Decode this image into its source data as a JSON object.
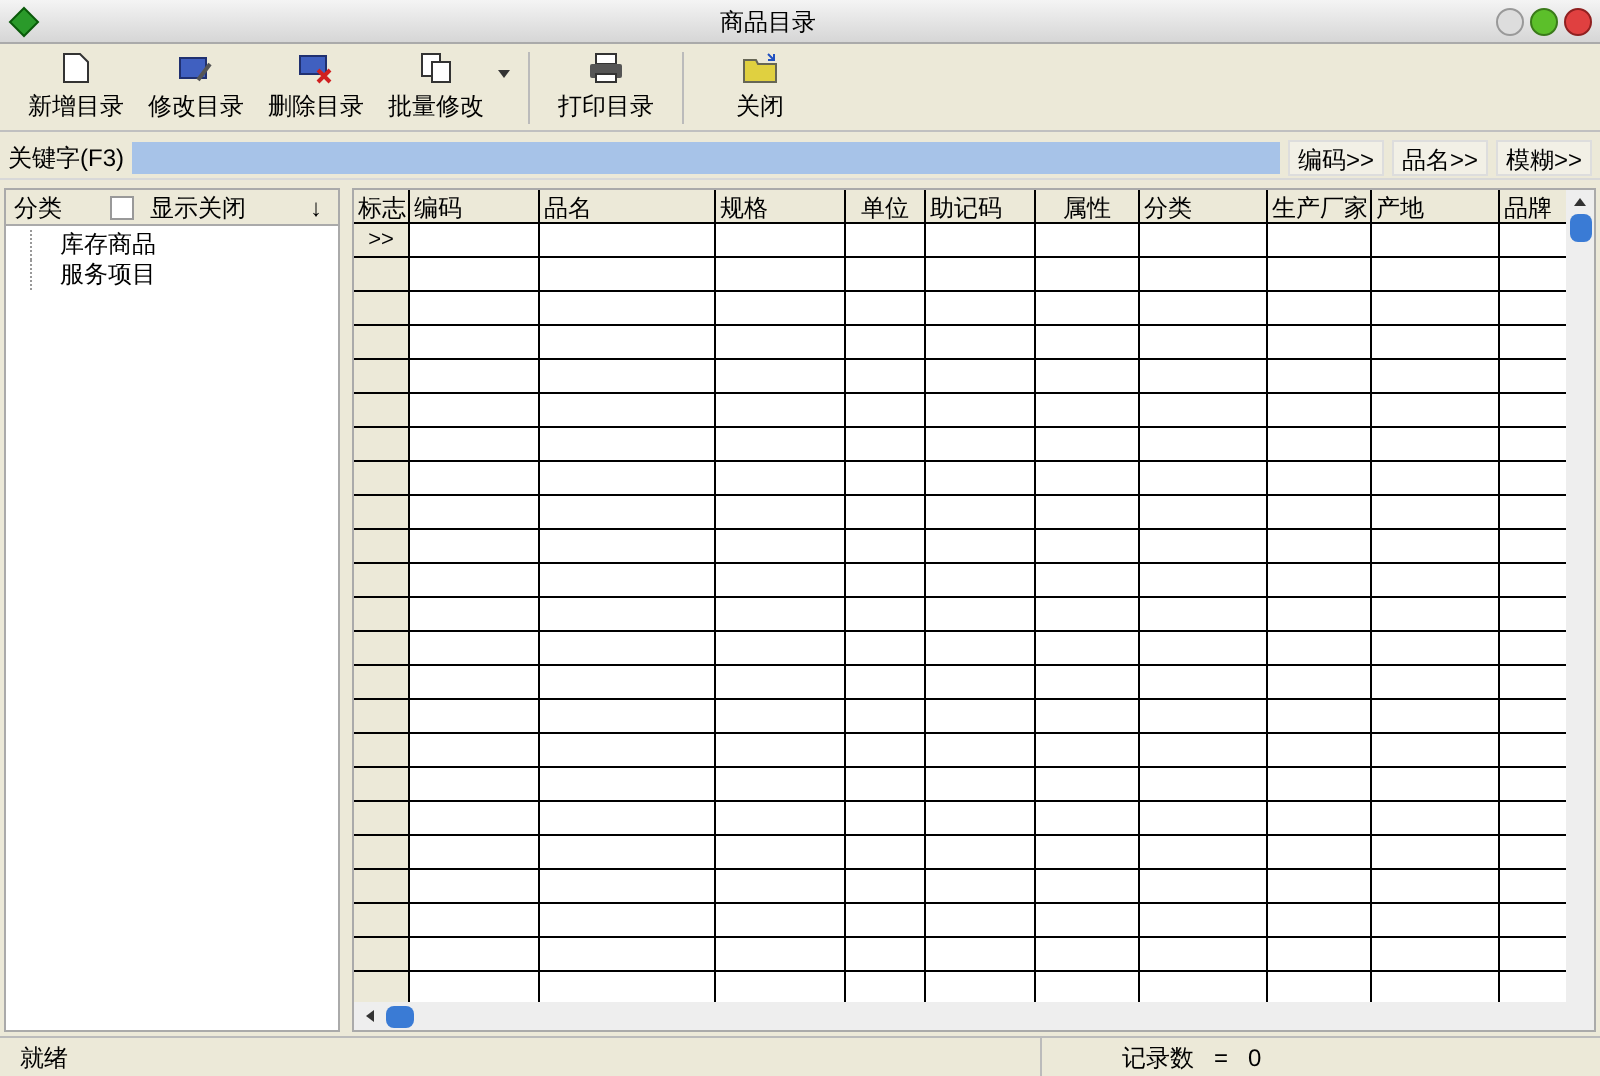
{
  "window": {
    "title": "商品目录"
  },
  "toolbar": [
    {
      "label": "新增目录",
      "kind": "new"
    },
    {
      "label": "修改目录",
      "kind": "edit"
    },
    {
      "label": "删除目录",
      "kind": "delete"
    },
    {
      "label": "批量修改",
      "kind": "batch"
    },
    {
      "label": "打印目录",
      "kind": "print"
    },
    {
      "label": "关闭",
      "kind": "close"
    }
  ],
  "search": {
    "label": "关键字(F3)",
    "buttons": [
      "编码>>",
      "品名>>",
      "模糊>>"
    ]
  },
  "sidebar": {
    "title": "分类",
    "checkbox": {
      "label": "显示关闭",
      "checked": false
    },
    "sort": "↓",
    "items": [
      {
        "label": "库存商品"
      },
      {
        "label": "服务项目"
      }
    ]
  },
  "table": {
    "columns": [
      "标志",
      "编码",
      "品名",
      "规格",
      "单位",
      "助记码",
      "属性",
      "分类",
      "生产厂家",
      "产地",
      "品牌"
    ],
    "current_row_marker": ">>",
    "rows": [
      {
        "current": true
      },
      {
        "current": false
      },
      {
        "current": false
      },
      {
        "current": false
      },
      {
        "current": false
      },
      {
        "current": false
      },
      {
        "current": false
      },
      {
        "current": false
      },
      {
        "current": false
      },
      {
        "current": false
      },
      {
        "current": false
      },
      {
        "current": false
      },
      {
        "current": false
      },
      {
        "current": false
      },
      {
        "current": false
      },
      {
        "current": false
      },
      {
        "current": false
      },
      {
        "current": false
      },
      {
        "current": false
      },
      {
        "current": false
      },
      {
        "current": false
      },
      {
        "current": false
      },
      {
        "current": false
      }
    ]
  },
  "status_bar": {
    "text": "就绪",
    "count_label": "记录数",
    "equals": "=",
    "count": "0"
  }
}
